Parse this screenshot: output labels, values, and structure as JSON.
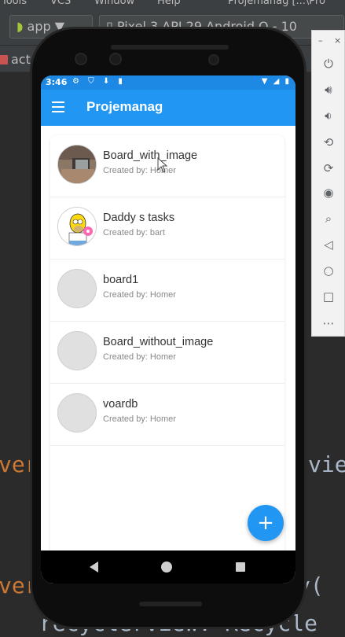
{
  "ide": {
    "menubar": [
      "Tools",
      "VCS",
      "Window",
      "Help",
      "Projemanag [...\\Pro"
    ],
    "run_config": "app",
    "device": "Pixel 3 API 29 Android Q - 10",
    "tab": "act",
    "code": {
      "line1_left": "ver",
      "line1_right": "vie",
      "line2_left": "ver",
      "line2_right": "y(",
      "line3": "recyclerView: Recycle"
    }
  },
  "emulator_panel": {
    "minimize": "–",
    "close": "×",
    "buttons": [
      "power-icon",
      "volume-up-icon",
      "volume-down-icon",
      "rotate-left-icon",
      "rotate-right-icon",
      "camera-icon",
      "zoom-icon",
      "back-icon",
      "home-icon",
      "overview-icon",
      "more-icon"
    ]
  },
  "phone": {
    "status": {
      "time": "3:46",
      "left_icons": "⚙ ⛉ ⬇ ▮",
      "right_icons": "▼ ◢ ▮"
    },
    "appbar": {
      "title": "Projemanag"
    },
    "boards": [
      {
        "name": "Board_with_image",
        "creator": "Created by: Homer"
      },
      {
        "name": "Daddy s tasks",
        "creator": "Created by: bart"
      },
      {
        "name": "board1",
        "creator": "Created by: Homer"
      },
      {
        "name": "Board_without_image",
        "creator": "Created by: Homer"
      },
      {
        "name": "voardb",
        "creator": "Created by: Homer"
      }
    ],
    "fab_label": "+"
  },
  "colors": {
    "primary": "#2196f3",
    "status_bar": "#1e88e5",
    "ide_bg": "#2b2b2b",
    "code_keyword": "#cc7832"
  }
}
